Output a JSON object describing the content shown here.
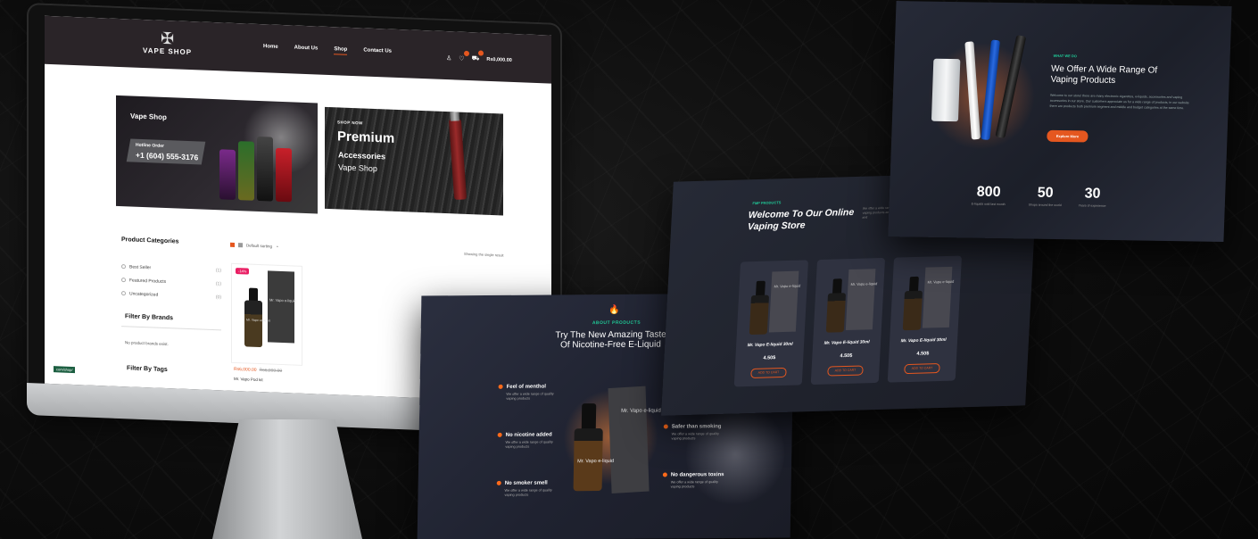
{
  "monitor_site": {
    "logo_text": "VAPE SHOP",
    "nav": [
      "Home",
      "About Us",
      "Shop",
      "Contact Us"
    ],
    "cart_total": "Rs0,000.00",
    "banner1": {
      "title": "Vape Shop",
      "hotline_label": "Hotline Order",
      "hotline_number": "+1 (604) 555-3176"
    },
    "banner2": {
      "kicker": "SHOP NOW",
      "line1": "Premium",
      "line2": "Accessories",
      "line3": "Vape Shop"
    },
    "categories_title": "Product Categories",
    "sorting": "Default sorting",
    "showing": "Showing the single result",
    "categories": [
      {
        "label": "Best Seller",
        "count": "(1)"
      },
      {
        "label": "Featured Products",
        "count": "(1)"
      },
      {
        "label": "Uncategorized",
        "count": "(0)"
      }
    ],
    "filter_brands_title": "Filter By Brands",
    "no_brands": "No product brands exist.",
    "filter_tags_title": "Filter By Tags",
    "corner_tag": "com/shop/",
    "product": {
      "sale_badge": "-14%",
      "box_label": "Mr. Vapo e-liquid",
      "bottle_label": "Mr. Vapo vape kit",
      "price_new": "Rs6,000.00",
      "price_old": "Rs6,999.00",
      "name": "Mr. Vapo Pod kit"
    }
  },
  "panel_about": {
    "kicker": "ABOUT PRODUCTS",
    "title": "Try The New Amazing Taste Of Nicotine-Free E-Liquid",
    "features": [
      {
        "title": "Feel of menthol",
        "desc": "We offer a wide range of quality vaping products"
      },
      {
        "title": "No nicotine added",
        "desc": "We offer a wide range of quality vaping products"
      },
      {
        "title": "No smoker smell",
        "desc": "We offer a wide range of quality vaping products"
      },
      {
        "title": "Safer than smoking",
        "desc": "We offer a wide range of quality vaping products"
      },
      {
        "title": "No dangerous toxins",
        "desc": "We offer a wide range of quality vaping products"
      }
    ],
    "box_label": "Mr. Vapo e-liquid",
    "bottle_label": "Mr. Vapo e-liquid"
  },
  "panel_featured": {
    "kicker": "FMP PRODUCTS",
    "title": "Welcome To Our Online Vaping Store",
    "sub": "We offer a wide range of quality vaping products and express delivery and",
    "cards": [
      {
        "name": "Mr. Vapo E-liquid 30ml",
        "price": "4.50$",
        "button": "ADD TO CART",
        "box_label": "Mr. Vapo e-liquid"
      },
      {
        "name": "Mr. Vapo E-liquid 30ml",
        "price": "4.50$",
        "button": "ADD TO CART",
        "box_label": "Mr. Vapo e-liquid"
      },
      {
        "name": "Mr. Vapo E-liquid 30ml",
        "price": "4.50$",
        "button": "ADD TO CART",
        "box_label": "Mr. Vapo e-liquid"
      }
    ]
  },
  "panel_whatwedo": {
    "kicker": "WHAT WE DO",
    "title": "We Offer A Wide Range Of Vaping Products",
    "desc": "Welcome to our store! there are many electronic cigarettes, e-liquids, accessories and vaping accessories in our store. Our customers appreciate us for a wide range of products, in our website there are products both premium segment and middle and budget categories at the same time.",
    "button": "Explore More",
    "stats": [
      {
        "value": "800",
        "label": "E-liquids sold last month"
      },
      {
        "value": "50",
        "label": "Shops around the world"
      },
      {
        "value": "30",
        "label": "Years of experience"
      }
    ]
  },
  "colors": {
    "accent": "#e5571f",
    "teal": "#20c997",
    "dark": "#1f222c"
  }
}
